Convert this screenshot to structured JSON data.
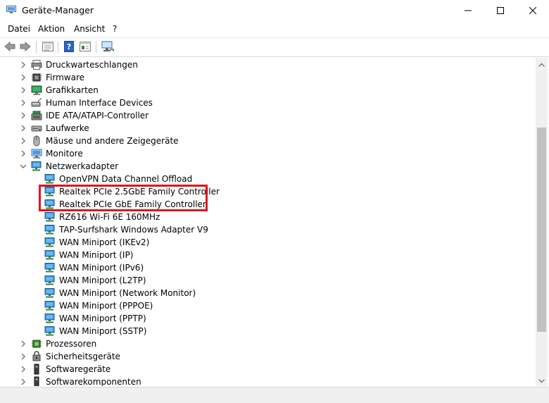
{
  "window": {
    "title": "Geräte-Manager",
    "minimize_icon": "minimize-icon",
    "maximize_icon": "maximize-icon",
    "close_icon": "close-icon"
  },
  "menu": {
    "file": "Datei",
    "action": "Aktion",
    "view": "Ansicht",
    "help": "?"
  },
  "toolbar": {
    "icons": [
      "back-icon",
      "forward-icon",
      "properties-icon",
      "help-icon",
      "view-icon",
      "monitor-icon"
    ]
  },
  "tree": {
    "categories_top": [
      "Druckwarteschlangen",
      "Firmware",
      "Grafikkarten",
      "Human Interface Devices",
      "IDE ATA/ATAPI-Controller",
      "Laufwerke",
      "Mäuse und andere Zeigegeräte",
      "Monitore"
    ],
    "network_category": "Netzwerkadapter",
    "network_devices": [
      "OpenVPN Data Channel Offload",
      "Realtek PCIe 2.5GbE Family Controller",
      "Realtek PCIe GbE Family Controller",
      "RZ616 Wi-Fi 6E 160MHz",
      "TAP-Surfshark Windows Adapter V9",
      "WAN Miniport (IKEv2)",
      "WAN Miniport (IP)",
      "WAN Miniport (IPv6)",
      "WAN Miniport (L2TP)",
      "WAN Miniport (Network Monitor)",
      "WAN Miniport (PPPOE)",
      "WAN Miniport (PPTP)",
      "WAN Miniport (SSTP)"
    ],
    "categories_bottom": [
      "Prozessoren",
      "Sicherheitsgeräte",
      "Softwaregeräte",
      "Softwarekomponenten"
    ]
  },
  "colors": {
    "highlight_border": "#e0141e",
    "network_icon": "#2f8fd8"
  }
}
